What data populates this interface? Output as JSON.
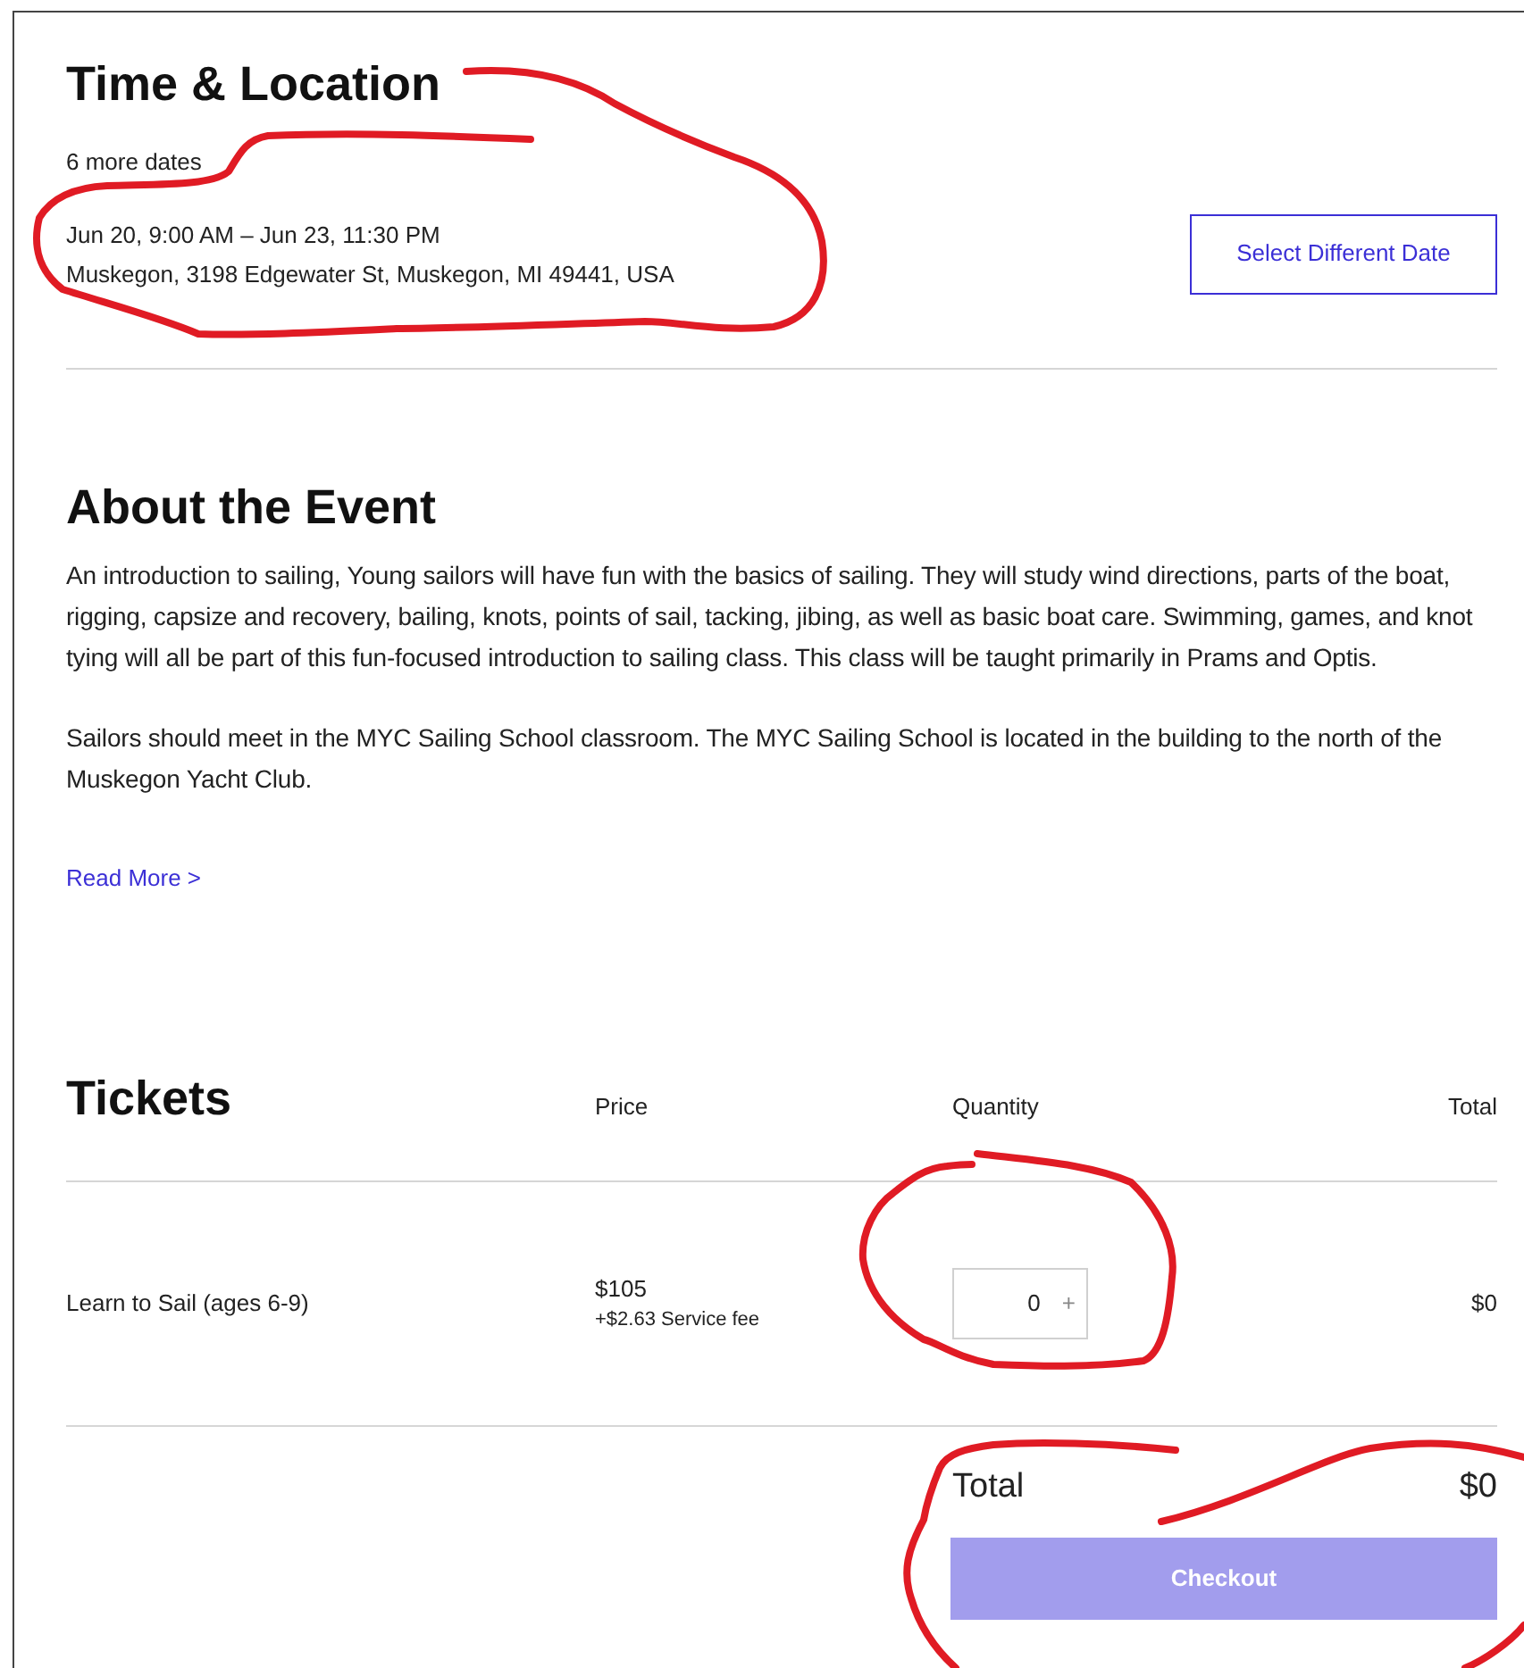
{
  "time_location": {
    "title": "Time & Location",
    "more_dates": "6 more dates",
    "date_range": "Jun 20, 9:00 AM – Jun 23, 11:30 PM",
    "address": "Muskegon, 3198 Edgewater St, Muskegon, MI 49441, USA",
    "select_button": "Select Different Date"
  },
  "about": {
    "title": "About the Event",
    "paragraphs": [
      "An introduction to sailing, Young sailors will have fun with the basics of sailing.  They will study wind directions, parts of the boat, rigging, capsize and recovery, bailing, knots, points of sail, tacking, jibing, as well as basic boat care. Swimming, games, and knot tying will all be part of this fun-focused introduction to sailing class. This class will be taught primarily in Prams and Optis.",
      "Sailors should meet in the MYC Sailing School classroom.  The MYC Sailing School is located in the building to the north of the Muskegon Yacht Club."
    ],
    "read_more": "Read More >"
  },
  "tickets": {
    "title": "Tickets",
    "columns": [
      "Price",
      "Quantity",
      "Total"
    ],
    "rows": [
      {
        "name": "Learn to Sail (ages 6-9)",
        "price": "$105",
        "fee": "+$2.63 Service fee",
        "quantity": "0",
        "increment": "+",
        "total": "$0"
      }
    ],
    "total_label": "Total",
    "total_value": "$0",
    "checkout": {
      "label": "Checkout",
      "disabled": true
    }
  }
}
